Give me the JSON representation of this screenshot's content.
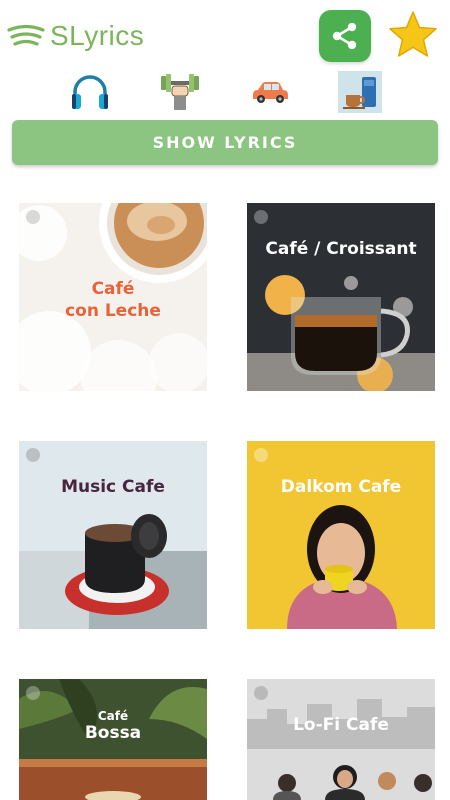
{
  "header": {
    "app_name": "SLyrics",
    "logo_icon": "spotify-wave-icon",
    "share_icon": "share-icon",
    "star_icon": "star-icon",
    "colors": {
      "brand": "#7cb45c",
      "share_bg": "#4caf50",
      "star": "#f5c518"
    }
  },
  "moods": [
    {
      "icon": "headphones-icon"
    },
    {
      "icon": "dumbbell-icon"
    },
    {
      "icon": "car-icon"
    },
    {
      "icon": "coffee-icon"
    }
  ],
  "show_lyrics_button": {
    "label": "SHOW LYRICS",
    "color": "#8bc581"
  },
  "playlists": [
    {
      "title_line1": "Café",
      "title_line2": "con Leche",
      "title_color": "#e8623a"
    },
    {
      "title_line1": "Café / Croissant",
      "title_line2": "",
      "title_color": "#ffffff"
    },
    {
      "title_line1": "Music Cafe",
      "title_line2": "",
      "title_color": "#4a2540"
    },
    {
      "title_line1": "Dalkom Cafe",
      "title_line2": "",
      "title_color": "#ffffff"
    },
    {
      "title_line1": "Café",
      "title_line2": "Bossa",
      "title_color": "#ffffff"
    },
    {
      "title_line1": "Lo-Fi Cafe",
      "title_line2": "",
      "title_color": "#ffffff"
    }
  ]
}
